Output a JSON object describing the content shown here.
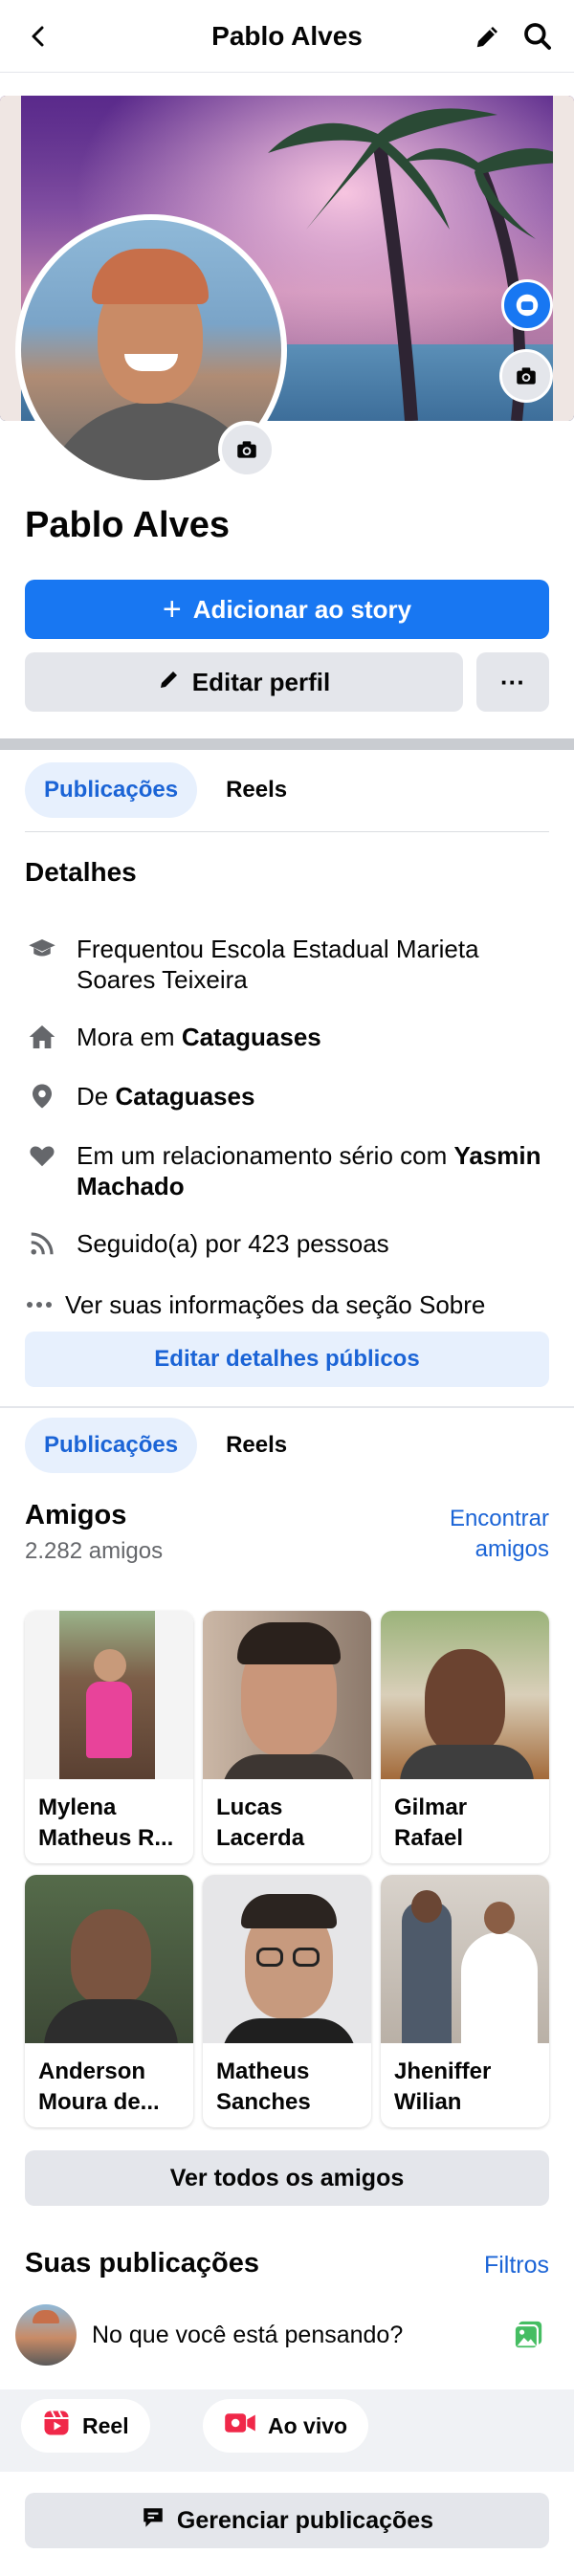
{
  "header": {
    "title": "Pablo Alves"
  },
  "profile": {
    "name": "Pablo Alves",
    "add_story_label": "Adicionar ao story",
    "edit_profile_label": "Editar perfil",
    "more_label": "···"
  },
  "tabs": [
    {
      "label": "Publicações",
      "active": true
    },
    {
      "label": "Reels",
      "active": false
    }
  ],
  "details": {
    "title": "Detalhes",
    "items": [
      {
        "icon": "graduation-cap-icon",
        "text": "Frequentou Escola Estadual Marieta Soares Teixeira"
      },
      {
        "icon": "home-icon",
        "prefix": "Mora em ",
        "bold": "Cataguases"
      },
      {
        "icon": "location-pin-icon",
        "prefix": "De ",
        "bold": "Cataguases"
      },
      {
        "icon": "heart-icon",
        "prefix": "Em um relacionamento sério com ",
        "bold": "Yasmin Machado"
      },
      {
        "icon": "rss-feed-icon",
        "text": "Seguido(a) por 423 pessoas"
      },
      {
        "icon": "more-dots-icon",
        "text": "Ver suas informações da seção Sobre"
      }
    ],
    "edit_public_label": "Editar detalhes públicos"
  },
  "friends": {
    "title": "Amigos",
    "count": "2.282 amigos",
    "find_label_line1": "Encontrar",
    "find_label_line2": "amigos",
    "list": [
      {
        "line1": "Mylena",
        "line2": "Matheus R..."
      },
      {
        "line1": "Lucas",
        "line2": "Lacerda"
      },
      {
        "line1": "Gilmar",
        "line2": "Rafael"
      },
      {
        "line1": "Anderson",
        "line2": "Moura de..."
      },
      {
        "line1": "Matheus",
        "line2": "Sanches"
      },
      {
        "line1": "Jheniffer",
        "line2": "Wilian"
      }
    ],
    "see_all_label": "Ver todos os amigos"
  },
  "posts": {
    "title": "Suas publicações",
    "filters_label": "Filtros",
    "composer_placeholder": "No que você está pensando?",
    "reel_label": "Reel",
    "live_label": "Ao vivo",
    "manage_label": "Gerenciar publicações"
  },
  "colors": {
    "primary": "#1877f2",
    "link": "#1b64d6",
    "light_blue": "#e7f0fd",
    "gray_button": "#e4e6eb",
    "reel_red": "#f02849",
    "photo_green": "#45bd62"
  }
}
